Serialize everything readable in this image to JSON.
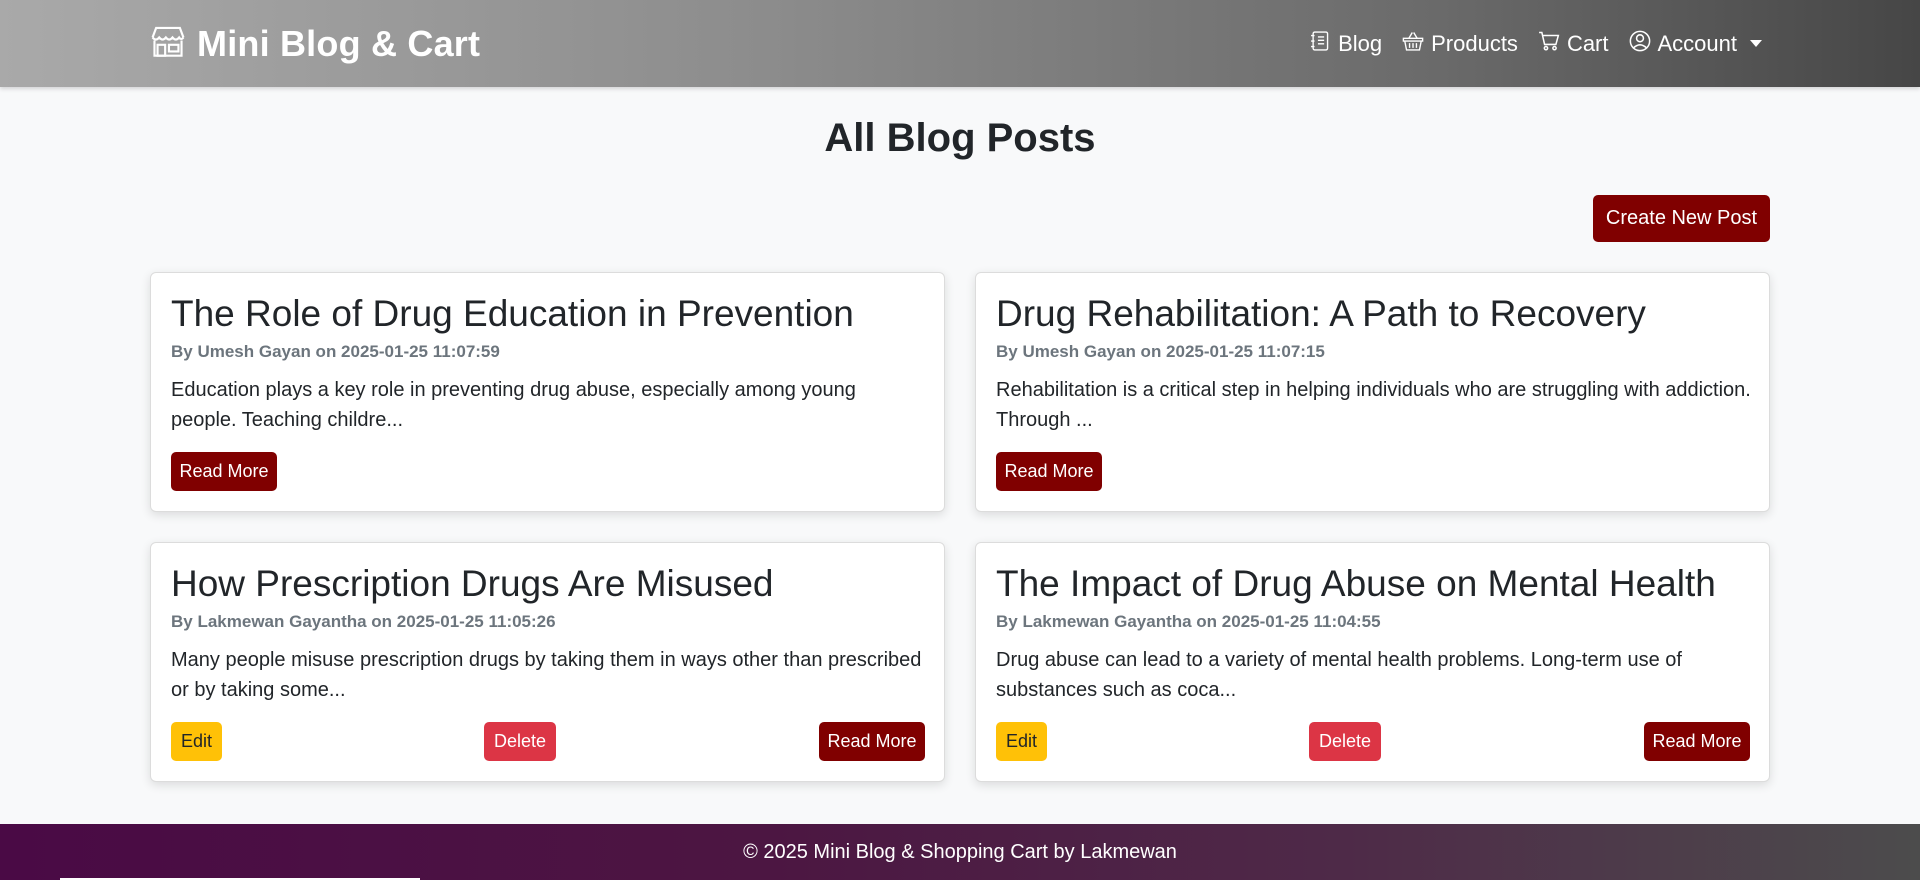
{
  "navbar": {
    "brand": "Mini Blog & Cart",
    "links": [
      {
        "label": "Blog",
        "icon": "journal-icon"
      },
      {
        "label": "Products",
        "icon": "basket-icon"
      },
      {
        "label": "Cart",
        "icon": "cart-icon"
      },
      {
        "label": "Account",
        "icon": "person-circle-icon"
      }
    ]
  },
  "main": {
    "title": "All Blog Posts",
    "create_button": "Create New Post",
    "posts": [
      {
        "title": "The Role of Drug Education in Prevention",
        "meta": "By Umesh Gayan on 2025-01-25 11:07:59",
        "excerpt": "Education plays a key role in preventing drug abuse, especially among young people. Teaching childre...",
        "read_more": "Read More"
      },
      {
        "title": "Drug Rehabilitation: A Path to Recovery",
        "meta": "By Umesh Gayan on 2025-01-25 11:07:15",
        "excerpt": "Rehabilitation is a critical step in helping individuals who are struggling with addiction. Through ...",
        "read_more": "Read More"
      },
      {
        "title": "How Prescription Drugs Are Misused",
        "meta": "By Lakmewan Gayantha on 2025-01-25 11:05:26",
        "excerpt": "Many people misuse prescription drugs by taking them in ways other than prescribed or by taking some...",
        "edit": "Edit",
        "delete": "Delete",
        "read_more": "Read More"
      },
      {
        "title": "The Impact of Drug Abuse on Mental Health",
        "meta": "By Lakmewan Gayantha on 2025-01-25 11:04:55",
        "excerpt": "Drug abuse can lead to a variety of mental health problems. Long-term use of substances such as coca...",
        "edit": "Edit",
        "delete": "Delete",
        "read_more": "Read More"
      }
    ]
  },
  "footer": {
    "text": "© 2025 Mini Blog & Shopping Cart by Lakmewan"
  },
  "colors": {
    "primary": "#800000",
    "warning": "#ffc107",
    "danger": "#dc3545",
    "footer": "#4a0a45"
  }
}
